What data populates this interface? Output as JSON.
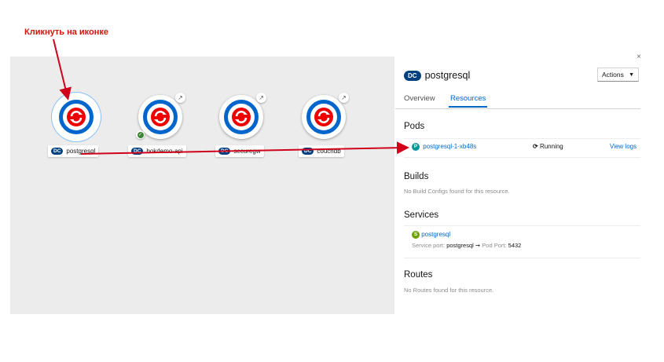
{
  "annotation": {
    "text": "Кликнуть на иконке"
  },
  "topology": {
    "nodes": [
      {
        "badge": "DC",
        "name": "postgresql",
        "selected": true,
        "external_link": false,
        "status_ok": false
      },
      {
        "badge": "DC",
        "name": "bokdemo-api",
        "selected": false,
        "external_link": true,
        "status_ok": true
      },
      {
        "badge": "DC",
        "name": "securegw",
        "selected": false,
        "external_link": true,
        "status_ok": false
      },
      {
        "badge": "DC",
        "name": "couchdb",
        "selected": false,
        "external_link": true,
        "status_ok": false
      }
    ]
  },
  "panel": {
    "close_glyph": "×",
    "badge": "DC",
    "title": "postgresql",
    "actions_label": "Actions",
    "tabs": [
      {
        "label": "Overview",
        "active": false
      },
      {
        "label": "Resources",
        "active": true
      }
    ],
    "pods": {
      "heading": "Pods",
      "items": [
        {
          "badge": "P",
          "name": "postgresql-1-xb48s",
          "status": "Running",
          "link": "View logs"
        }
      ]
    },
    "builds": {
      "heading": "Builds",
      "empty": "No Build Configs found for this resource."
    },
    "services": {
      "heading": "Services",
      "items": [
        {
          "badge": "S",
          "name": "postgresql",
          "port_label": "Service port:",
          "port": "postgresql",
          "arrow": "➞",
          "pod_port_label": "Pod Port:",
          "pod_port": "5432"
        }
      ]
    },
    "routes": {
      "heading": "Routes",
      "empty": "No Routes found for this resource."
    }
  },
  "colors": {
    "accent": "#0066cc",
    "annotation": "#c9190b",
    "canvas": "#ececec",
    "dc_badge": "#004080",
    "pod_badge": "#009596",
    "svc_badge": "#6ca100"
  }
}
